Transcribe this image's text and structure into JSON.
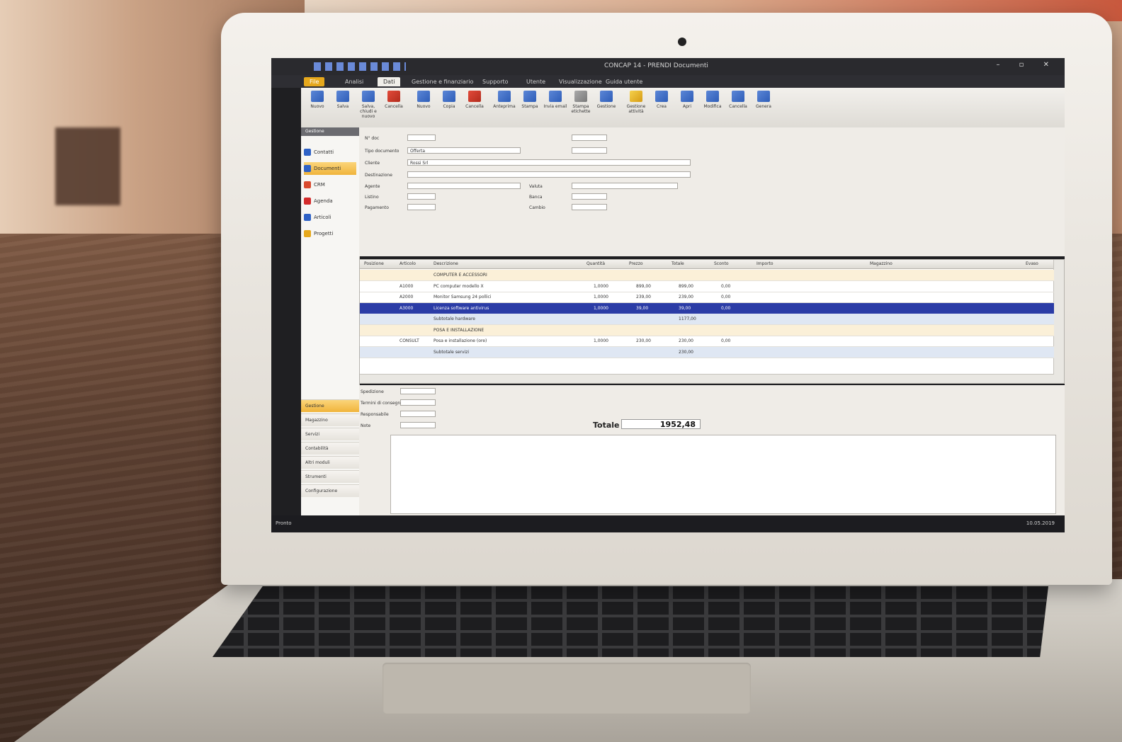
{
  "app": {
    "window_title": "CONCAP 14 - PRENDI Documenti"
  },
  "ribbon_tabs": [
    "File",
    "Analisi",
    "Dati",
    "Gestione e finanziario",
    "Supporto",
    "Utente",
    "Visualizzazione",
    "Guida utente"
  ],
  "ribbon_buttons": [
    {
      "label": "Nuovo",
      "icon": "new-icon"
    },
    {
      "label": "Salva",
      "icon": "save-icon"
    },
    {
      "label": "Salva, chiudi e nuovo",
      "icon": "save-close-icon"
    },
    {
      "label": "Cancella",
      "icon": "delete-icon"
    },
    {
      "label": "Nuovo",
      "icon": "new-row-icon"
    },
    {
      "label": "Copia",
      "icon": "copy-icon"
    },
    {
      "label": "Cancella",
      "icon": "remove-icon"
    },
    {
      "label": "Anteprima",
      "icon": "preview-icon"
    },
    {
      "label": "Stampa",
      "icon": "print-icon"
    },
    {
      "label": "Invia email",
      "icon": "email-icon"
    },
    {
      "label": "Stampa etichette",
      "icon": "labels-icon"
    },
    {
      "label": "Gestione",
      "icon": "manage-icon"
    },
    {
      "label": "Gestione attività",
      "icon": "activity-icon"
    },
    {
      "label": "Crea",
      "icon": "create-icon"
    },
    {
      "label": "Apri",
      "icon": "open-icon"
    },
    {
      "label": "Modifica",
      "icon": "edit-icon"
    },
    {
      "label": "Cancella",
      "icon": "cancel-icon"
    },
    {
      "label": "Genera",
      "icon": "generate-icon"
    }
  ],
  "left_nav": {
    "header": "Gestione",
    "items": [
      {
        "label": "Contatti",
        "color": "#2f62c6"
      },
      {
        "label": "Documenti",
        "color": "#2f62c6",
        "active": true
      },
      {
        "label": "CRM",
        "color": "#d94a2e"
      },
      {
        "label": "Agenda",
        "color": "#d42b2b"
      },
      {
        "label": "Articoli",
        "color": "#2f62c6"
      },
      {
        "label": "Progetti",
        "color": "#e6a81c"
      }
    ],
    "bottom": [
      "Gestione",
      "Magazzino",
      "Servizi",
      "Contabilità",
      "Altri moduli",
      "Strumenti",
      "Configurazione"
    ]
  },
  "form": {
    "labels": [
      "N° doc",
      "Tipo documento",
      "Cliente",
      "Destinazione",
      "Agente",
      "Listino",
      "Pagamento",
      "Valuta",
      "Banca",
      "Cambio"
    ],
    "tipo_documento": "Offerta",
    "cliente_value": "Rossi Srl"
  },
  "grid": {
    "headers": [
      "Posizione",
      "Articolo",
      "Descrizione",
      "Quantità",
      "Prezzo",
      "Totale",
      "Sconto",
      "Importo",
      "Magazzino",
      "Evaso"
    ],
    "rows": [
      {
        "type": "group",
        "descr": "COMPUTER E ACCESSORI"
      },
      {
        "type": "row",
        "art": "A1000",
        "descr": "PC computer modello X",
        "qty": "1,0000",
        "price": "899,00",
        "total": "899,00",
        "disc": "0,00"
      },
      {
        "type": "row",
        "art": "A2000",
        "descr": "Monitor Samsung 24 pollici",
        "qty": "1,0000",
        "price": "239,00",
        "total": "239,00",
        "disc": "0,00"
      },
      {
        "type": "sel",
        "art": "A3000",
        "descr": "Licenza software antivirus",
        "qty": "1,0000",
        "price": "39,00",
        "total": "39,00",
        "disc": "0,00"
      },
      {
        "type": "sub",
        "descr": "Subtotale hardware",
        "total": "1177,00"
      },
      {
        "type": "group",
        "descr": "POSA E INSTALLAZIONE"
      },
      {
        "type": "row",
        "art": "CONSULT",
        "descr": "Posa e installazione (ore)",
        "qty": "1,0000",
        "price": "230,00",
        "total": "230,00",
        "disc": "0,00"
      },
      {
        "type": "sub",
        "descr": "Subtotale servizi",
        "total": "230,00"
      }
    ]
  },
  "bottom": {
    "labels": [
      "Spedizione",
      "Termini di consegna",
      "Responsabile",
      "Note"
    ],
    "total_label": "Totale",
    "total_value": "1952,48"
  },
  "status": {
    "left": "Pronto",
    "right": "10.05.2019"
  }
}
